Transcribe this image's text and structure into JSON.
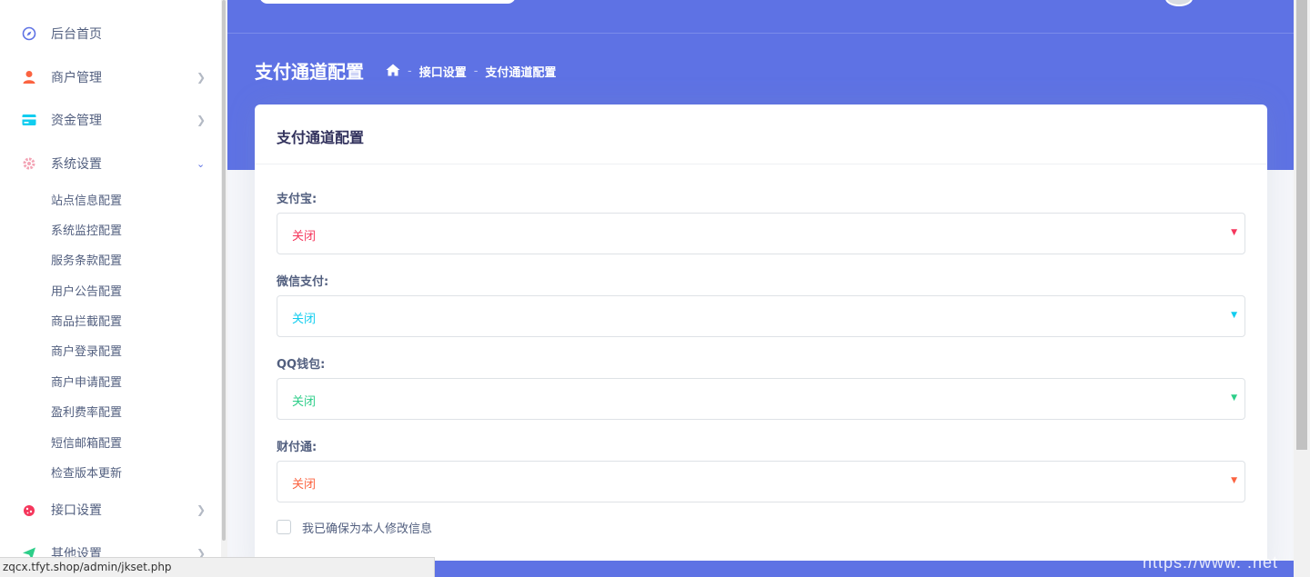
{
  "sidebar": {
    "items": [
      {
        "label": "后台首页",
        "icon": "compass-icon",
        "color": "#5e72e4"
      },
      {
        "label": "商户管理",
        "icon": "user-icon",
        "color": "#f5365c"
      },
      {
        "label": "资金管理",
        "icon": "card-icon",
        "color": "#11cdef"
      },
      {
        "label": "系统设置",
        "icon": "gear-icon",
        "color": "#f3a4b5"
      }
    ],
    "sub_items": [
      "站点信息配置",
      "系统监控配置",
      "服务条款配置",
      "用户公告配置",
      "商品拦截配置",
      "商户登录配置",
      "商户申请配置",
      "盈利费率配置",
      "短信邮箱配置",
      "检查版本更新"
    ],
    "bottom_items": [
      {
        "label": "接口设置",
        "icon": "bug-icon",
        "color": "#f5365c"
      },
      {
        "label": "其他设置",
        "icon": "send-icon",
        "color": "#2dce89"
      }
    ]
  },
  "header": {
    "title": "支付通道配置",
    "breadcrumb": [
      "接口设置",
      "支付通道配置"
    ]
  },
  "card": {
    "title": "支付通道配置",
    "fields": [
      {
        "label": "支付宝:",
        "value": "关闭",
        "color": "#f5365c"
      },
      {
        "label": "微信支付:",
        "value": "关闭",
        "color": "#11cdef"
      },
      {
        "label": "QQ钱包:",
        "value": "关闭",
        "color": "#2dce89"
      },
      {
        "label": "财付通:",
        "value": "关闭",
        "color": "#fb6340"
      }
    ],
    "confirm_label": "我已确保为本人修改信息"
  },
  "status_url": "zqcx.tfyt.shop/admin/jkset.php",
  "watermark": "https://www.    .net"
}
